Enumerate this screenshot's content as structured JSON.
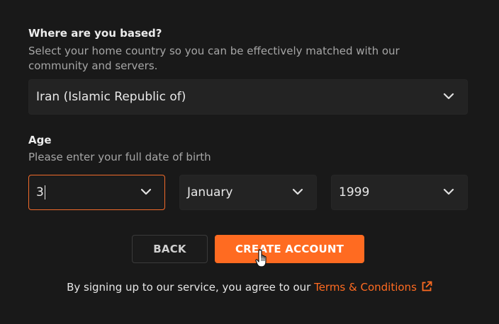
{
  "location": {
    "title": "Where are you based?",
    "description_line1": "Select your home country so you can be effectively matched with our",
    "description_line2": "community and servers.",
    "country_value": "Iran (Islamic Republic of)"
  },
  "age": {
    "title": "Age",
    "description": "Please enter your full date of birth",
    "day_value": "3",
    "month_value": "January",
    "year_value": "1999"
  },
  "buttons": {
    "back_label": "BACK",
    "create_label": "CREATE ACCOUNT"
  },
  "footer": {
    "text": "By signing up to our service, you agree to our ",
    "link_text": "Terms & Conditions"
  },
  "colors": {
    "accent": "#ff6b21",
    "focus_border": "#f06a2a",
    "background": "#191919",
    "field_bg": "#232323"
  },
  "icons": {
    "dropdown": "chevron-down-icon",
    "external": "external-link-icon",
    "cursor": "hand-pointer-cursor"
  }
}
